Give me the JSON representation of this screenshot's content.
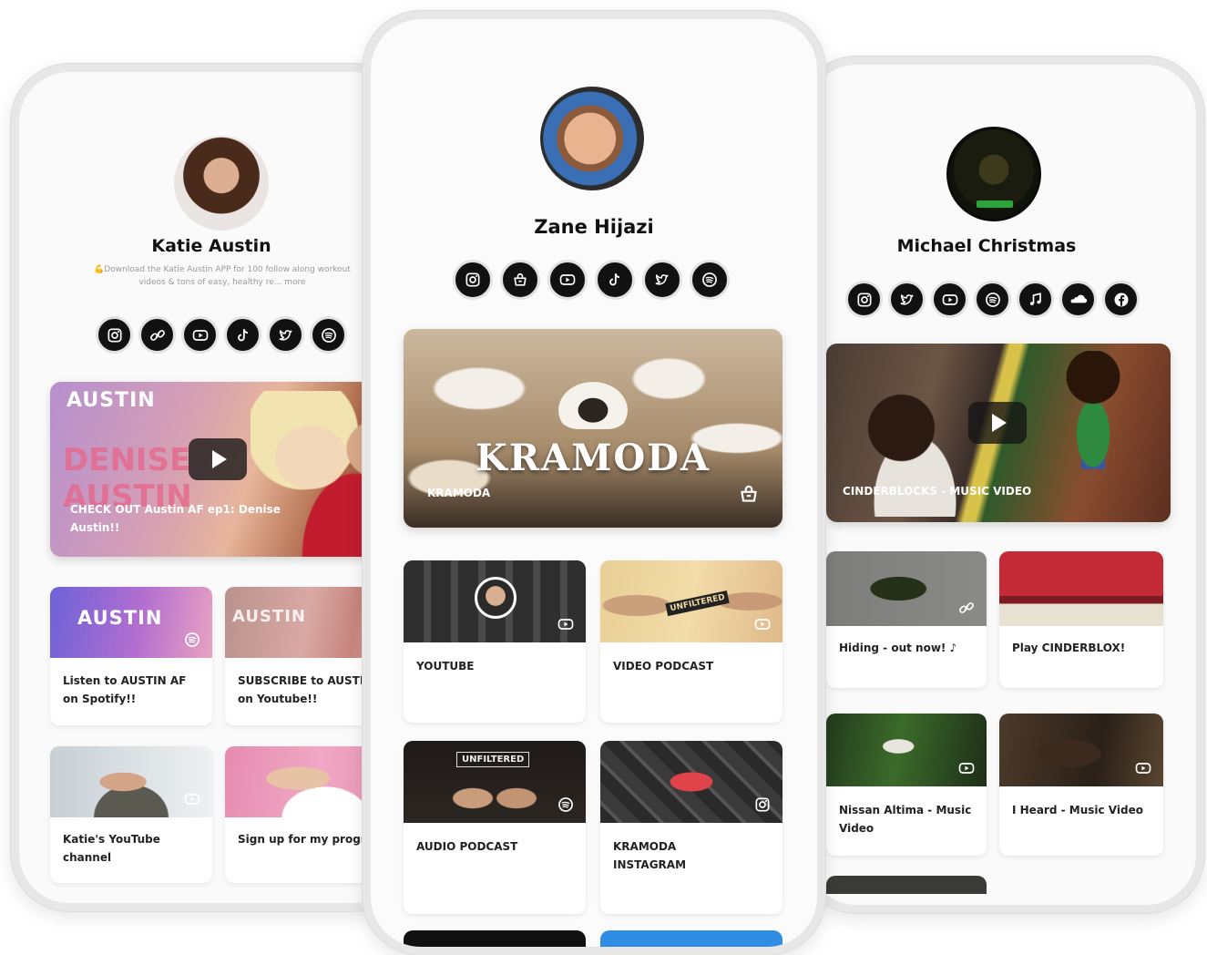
{
  "left": {
    "name": "Katie Austin",
    "bio": "💪Download the Katie Austin APP for 100 follow along workout videos & tons of easy, healthy re... more",
    "socials": [
      "instagram-icon",
      "link-icon",
      "youtube-icon",
      "tiktok-icon",
      "twitter-icon",
      "spotify-icon"
    ],
    "featured": {
      "brand": "AUSTIN",
      "overlay_text": "DENISE AUSTIN",
      "caption": "CHECK OUT Austin AF ep1: Denise Austin!!"
    },
    "cards": [
      {
        "brand": "AUSTIN",
        "label": "Listen to AUSTIN AF on Spotify!!"
      },
      {
        "brand": "AUSTIN",
        "label": "SUBSCRIBE to AUSTIN AF on Youtube!!"
      },
      {
        "label": "Katie's YouTube channel"
      },
      {
        "label": "Sign up for my program!"
      }
    ]
  },
  "center": {
    "name": "Zane Hijazi",
    "socials": [
      "instagram-icon",
      "shop-icon",
      "youtube-icon",
      "tiktok-icon",
      "twitter-icon",
      "spotify-icon"
    ],
    "featured": {
      "logo": "KRAMODA",
      "caption": "KRAMODA"
    },
    "cards": [
      {
        "label": "YOUTUBE"
      },
      {
        "thumb_text": "UNFILTERED",
        "label": "VIDEO PODCAST"
      },
      {
        "thumb_text": "UNFILTERED",
        "label": "AUDIO PODCAST"
      },
      {
        "label": "KRAMODA INSTAGRAM"
      }
    ]
  },
  "right": {
    "name": "Michael Christmas",
    "socials": [
      "instagram-icon",
      "twitter-icon",
      "youtube-icon",
      "spotify-icon",
      "music-icon",
      "soundcloud-icon",
      "facebook-icon"
    ],
    "featured": {
      "caption": "CINDERBLOCKS - MUSIC VIDEO"
    },
    "cards": [
      {
        "label": "Hiding - out now! ♪"
      },
      {
        "label": "Play CINDERBLOX!"
      },
      {
        "label": "Nissan Altima - Music Video"
      },
      {
        "label": "I Heard - Music Video"
      }
    ]
  },
  "colors": {
    "icon_bg": "#111111",
    "icon_ring": "#e2e2e2",
    "card_bg": "#ffffff",
    "phone_frame": "#e7e7e7"
  }
}
